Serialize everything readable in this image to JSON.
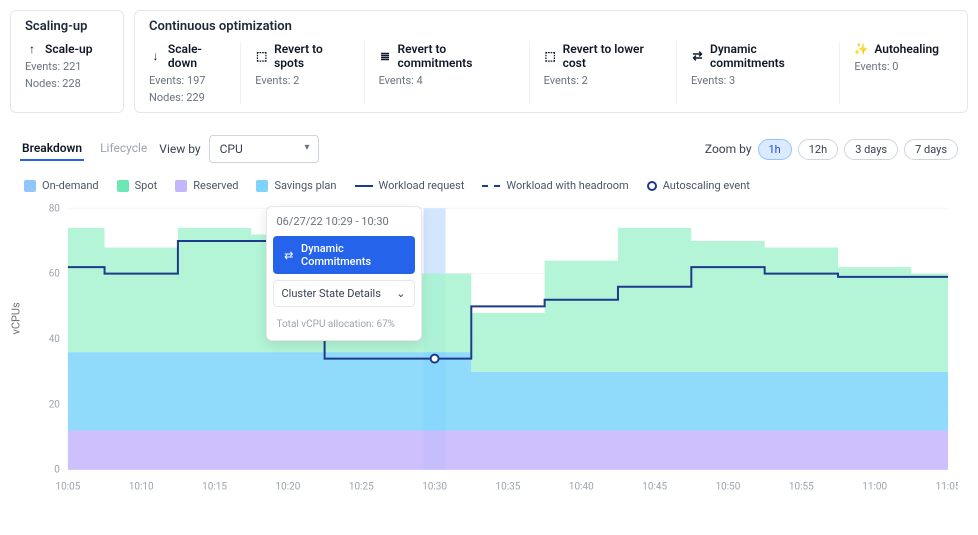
{
  "groups": {
    "scaling_up": {
      "title": "Scaling-up",
      "cards": [
        {
          "name": "scale-up",
          "icon": "arrow-up-icon",
          "label": "Scale-up",
          "lines": [
            "Events: 221",
            "Nodes: 228"
          ]
        }
      ]
    },
    "continuous": {
      "title": "Continuous optimization",
      "cards": [
        {
          "name": "scale-down",
          "icon": "arrow-down-icon",
          "label": "Scale-down",
          "lines": [
            "Events: 197",
            "Nodes: 229"
          ]
        },
        {
          "name": "revert-spots",
          "icon": "cube-icon",
          "label": "Revert to spots",
          "lines": [
            "Events: 2"
          ]
        },
        {
          "name": "revert-commitments",
          "icon": "stack-icon",
          "label": "Revert to commitments",
          "lines": [
            "Events: 4"
          ]
        },
        {
          "name": "revert-lower-cost",
          "icon": "tag-icon",
          "label": "Revert to lower cost",
          "lines": [
            "Events: 2"
          ]
        },
        {
          "name": "dynamic-commitments",
          "icon": "swap-icon",
          "label": "Dynamic commitments",
          "lines": [
            "Events: 3"
          ]
        },
        {
          "name": "autohealing",
          "icon": "wand-icon",
          "label": "Autohealing",
          "lines": [
            "Events: 0"
          ]
        }
      ]
    }
  },
  "controls": {
    "tabs": [
      "Breakdown",
      "Lifecycle"
    ],
    "active_tab": "Breakdown",
    "viewby_label": "View by",
    "viewby_value": "CPU",
    "zoom_label": "Zoom by",
    "zoom_options": [
      "1h",
      "12h",
      "3 days",
      "7 days"
    ],
    "zoom_active": "1h"
  },
  "legend": [
    {
      "label": "On-demand",
      "type": "swatch",
      "color": "#93c5fd"
    },
    {
      "label": "Spot",
      "type": "swatch",
      "color": "#6ee7b7"
    },
    {
      "label": "Reserved",
      "type": "swatch",
      "color": "#c4b5fd"
    },
    {
      "label": "Savings plan",
      "type": "swatch",
      "color": "#7dd3fc"
    },
    {
      "label": "Workload request",
      "type": "line"
    },
    {
      "label": "Workload with headroom",
      "type": "dash"
    },
    {
      "label": "Autoscaling event",
      "type": "circle"
    }
  ],
  "tooltip": {
    "time": "06/27/22 10:29 - 10:30",
    "badge": "Dynamic Commitments",
    "dropdown": "Cluster State Details",
    "footer": "Total vCPU allocation: 67%"
  },
  "chart_data": {
    "type": "area",
    "title": "",
    "xlabel": "",
    "ylabel": "vCPUs",
    "ylim": [
      0,
      80
    ],
    "x_ticks": [
      "10:05",
      "10:10",
      "10:15",
      "10:20",
      "10:25",
      "10:30",
      "10:35",
      "10:40",
      "10:45",
      "10:50",
      "10:55",
      "11:00",
      "11:05"
    ],
    "y_ticks": [
      0,
      20,
      40,
      60,
      80
    ],
    "highlight_index": 5,
    "stacked_series": [
      {
        "name": "Reserved",
        "color": "#c4b5fd",
        "values": [
          12,
          12,
          12,
          12,
          12,
          12,
          12,
          12,
          12,
          12,
          12,
          12,
          12
        ]
      },
      {
        "name": "Savings plan",
        "color": "#7dd3fc",
        "values": [
          24,
          24,
          24,
          24,
          24,
          24,
          18,
          18,
          18,
          18,
          18,
          18,
          18
        ]
      },
      {
        "name": "On-demand",
        "color": "#93c5fd",
        "values": [
          0,
          0,
          0,
          0,
          0,
          0,
          0,
          0,
          0,
          0,
          0,
          0,
          0
        ]
      },
      {
        "name": "Spot",
        "color": "#a7f3d0",
        "values": [
          38,
          32,
          38,
          36,
          24,
          24,
          18,
          34,
          44,
          40,
          38,
          32,
          30
        ]
      }
    ],
    "lines": [
      {
        "name": "Workload request",
        "color": "#1e3a8a",
        "dash": false,
        "values": [
          62,
          60,
          70,
          70,
          34,
          34,
          50,
          52,
          56,
          62,
          60,
          59,
          59
        ]
      }
    ],
    "event_point": {
      "index": 5,
      "value": 34
    }
  },
  "colors": {
    "primary": "#2563eb",
    "text_muted": "#6b7280",
    "border": "#e5e7eb"
  }
}
